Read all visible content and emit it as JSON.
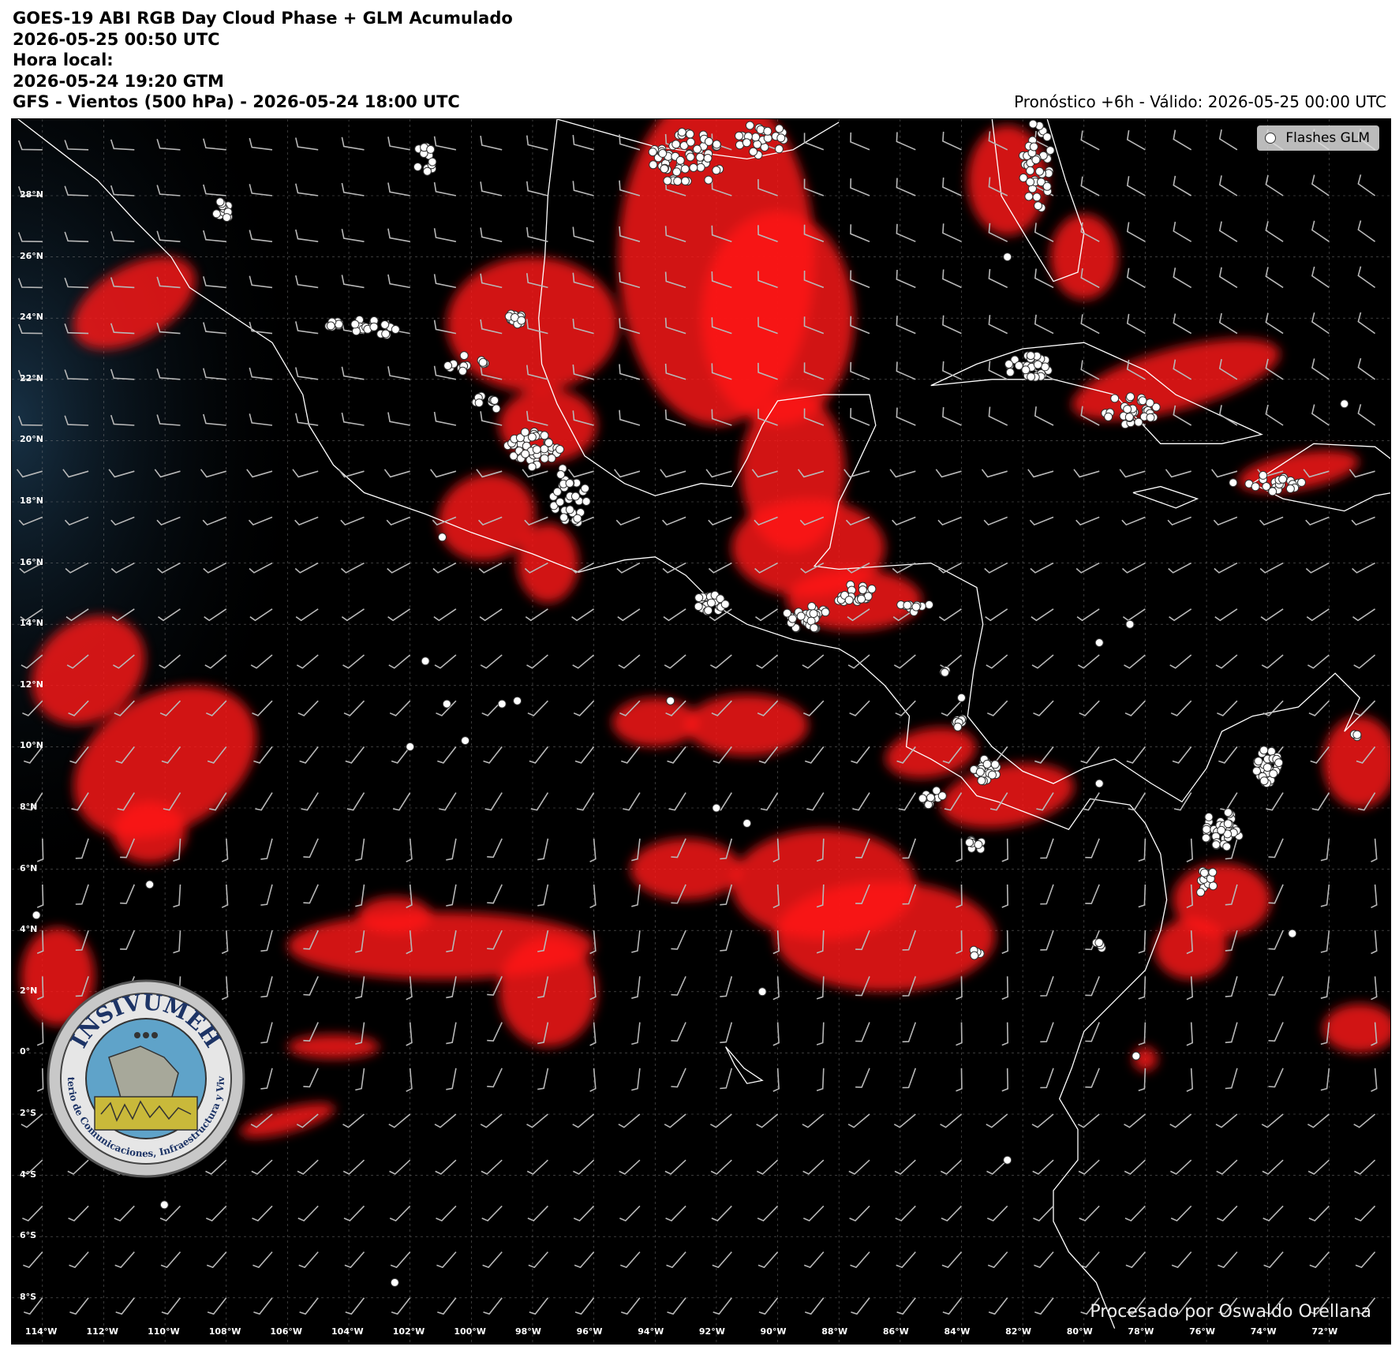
{
  "header": {
    "title_lines": [
      "GOES-19 ABI RGB Day Cloud Phase + GLM Acumulado",
      "2026-05-25 00:50 UTC",
      "Hora local:",
      "2026-05-24 19:20 GTM",
      "GFS - Vientos (500 hPa) - 2026-05-24 18:00 UTC"
    ],
    "forecast_label": "Pronóstico +6h - Válido: 2026-05-25 00:00 UTC"
  },
  "map": {
    "extent": {
      "lon_min": -115,
      "lon_max": -70,
      "lat_min": -9.5,
      "lat_max": 30.5
    },
    "lat_labels": [
      "28°N",
      "26°N",
      "24°N",
      "22°N",
      "20°N",
      "18°N",
      "16°N",
      "14°N",
      "12°N",
      "10°N",
      "8°N",
      "6°N",
      "4°N",
      "2°N",
      "0°",
      "2°S",
      "4°S",
      "6°S",
      "8°S"
    ],
    "lat_values": [
      28,
      26,
      24,
      22,
      20,
      18,
      16,
      14,
      12,
      10,
      8,
      6,
      4,
      2,
      0,
      -2,
      -4,
      -6,
      -8
    ],
    "lon_labels": [
      "114°W",
      "112°W",
      "110°W",
      "108°W",
      "106°W",
      "104°W",
      "102°W",
      "100°W",
      "98°W",
      "96°W",
      "94°W",
      "92°W",
      "90°W",
      "88°W",
      "86°W",
      "84°W",
      "82°W",
      "80°W",
      "78°W",
      "76°W",
      "74°W",
      "72°W"
    ],
    "lon_values": [
      -114,
      -112,
      -110,
      -108,
      -106,
      -104,
      -102,
      -100,
      -98,
      -96,
      -94,
      -92,
      -90,
      -88,
      -86,
      -84,
      -82,
      -80,
      -78,
      -76,
      -74,
      -72
    ],
    "background_color": "#000000",
    "cloud_color": "#ff1a1a",
    "coast_color": "#ffffff",
    "barb_color": "#b8b8b8"
  },
  "legend": {
    "label": "Flashes GLM",
    "marker_color": "#ffffff"
  },
  "credit": "Procesado por Oswaldo Orellana",
  "logo": {
    "name": "INSIVUMEH",
    "ring_text": "Ministerio de Comunicaciones, Infraestructura y Vivienda"
  }
}
